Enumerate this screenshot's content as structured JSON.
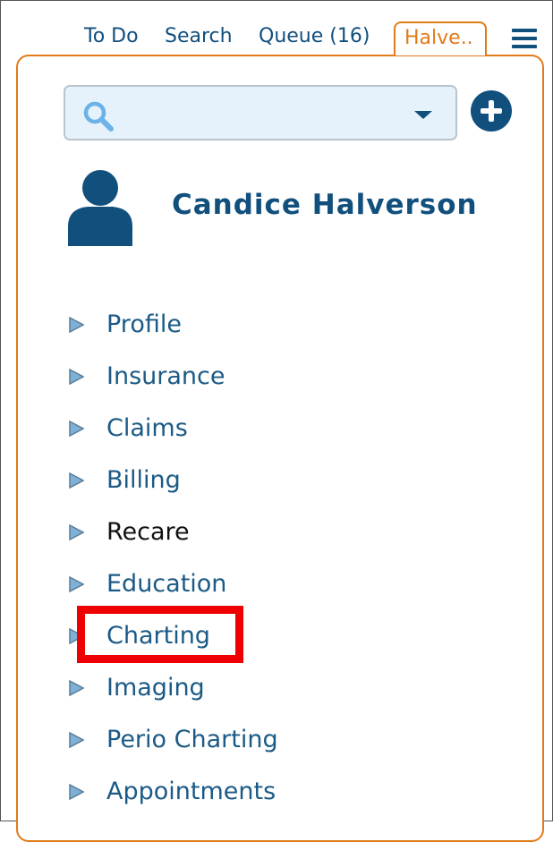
{
  "tabs": [
    {
      "label": "To Do"
    },
    {
      "label": "Search"
    },
    {
      "label": "Queue (16)"
    }
  ],
  "active_tab": {
    "label": "Halve.."
  },
  "search": {
    "placeholder": "",
    "value": ""
  },
  "patient": {
    "name": "Candice Halverson"
  },
  "nav": {
    "items": [
      {
        "label": "Profile"
      },
      {
        "label": "Insurance"
      },
      {
        "label": "Claims"
      },
      {
        "label": "Billing"
      },
      {
        "label": "Recare"
      },
      {
        "label": "Education"
      },
      {
        "label": "Charting"
      },
      {
        "label": "Imaging"
      },
      {
        "label": "Perio Charting"
      },
      {
        "label": "Appointments"
      }
    ]
  },
  "colors": {
    "primary": "#114f7d",
    "accent": "#e17b1a",
    "search_bg": "#e6f2fb",
    "highlight": "#ee0000"
  },
  "icons": {
    "search": "search-icon",
    "caret": "chevron-down-icon",
    "add": "plus-circle-icon",
    "avatar": "user-icon",
    "menu": "hamburger-menu-icon",
    "nav_arrow": "triangle-right-icon"
  }
}
